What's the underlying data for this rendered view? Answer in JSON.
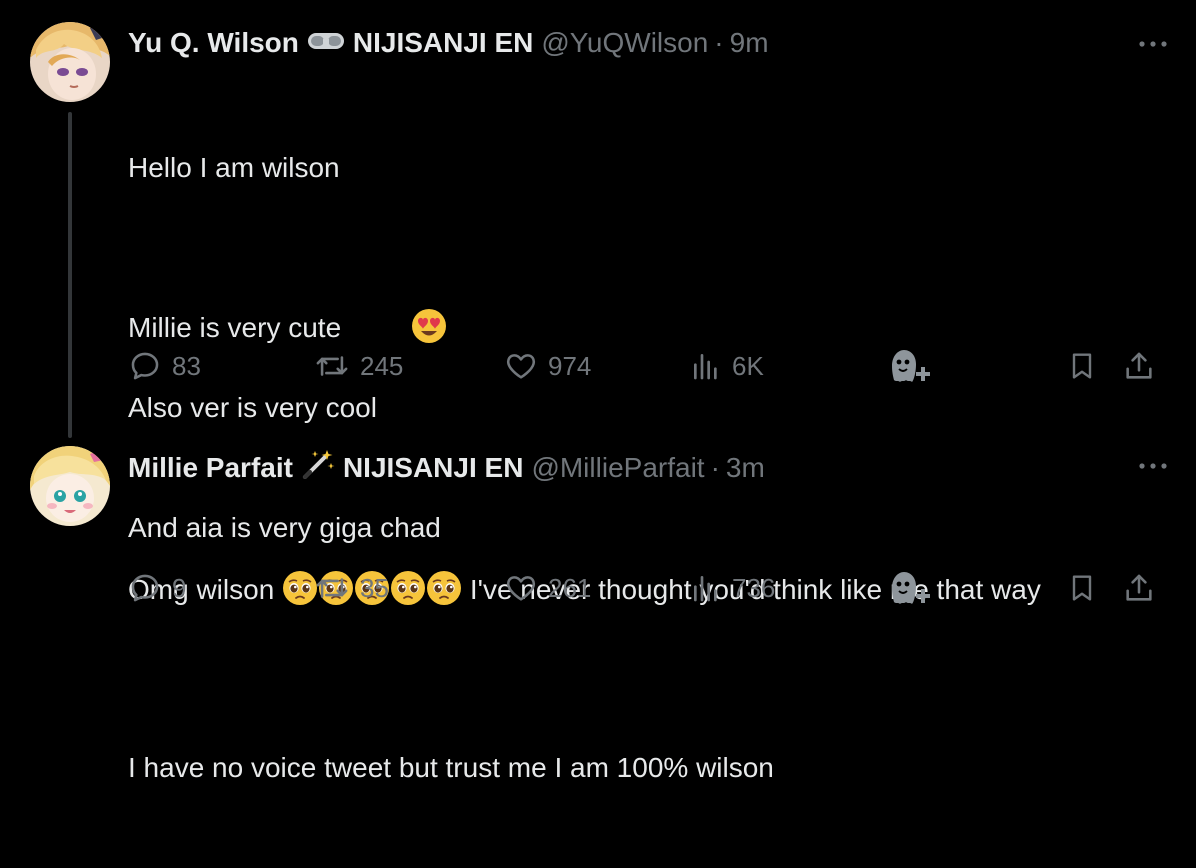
{
  "tweets": [
    {
      "name": "Yu Q. Wilson",
      "badge_icon": "vr-goggles-icon",
      "affiliation": "NIJISANJI EN",
      "handle": "@YuQWilson",
      "separator": "·",
      "time": "9m",
      "lines": {
        "l1": "Hello I am wilson",
        "l2": "Millie is very cute",
        "l3": "Also ver is very cool",
        "l4": "And aia is very giga chad",
        "l5": "",
        "l6": "I have no voice tweet but trust me I am 100% wilson"
      },
      "stats": {
        "replies": "83",
        "reposts": "245",
        "likes": "974",
        "views": "6K"
      }
    },
    {
      "name": "Millie Parfait",
      "badge_icon": "magic-wand-icon",
      "affiliation": "NIJISANJI EN",
      "handle": "@MillieParfait",
      "separator": "·",
      "time": "3m",
      "lines": {
        "pre": "Omg wilson",
        "post": "I've never thought you'd think like me that way"
      },
      "stats": {
        "replies": "9",
        "reposts": "35",
        "likes": "261",
        "views": "736"
      }
    }
  ],
  "colors": {
    "background": "#000000",
    "text": "#e7e9ea",
    "muted": "#71767b",
    "thread": "#333639"
  }
}
